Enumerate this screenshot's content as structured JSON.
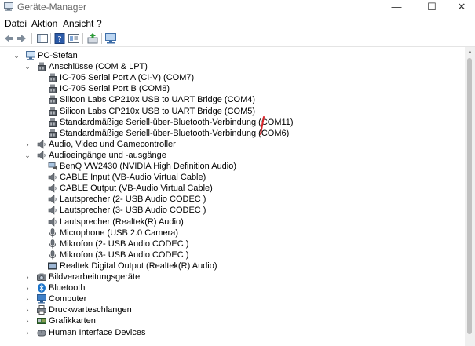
{
  "window": {
    "title": "Geräte-Manager",
    "controls": {
      "minimize": "—",
      "maximize": "☐",
      "close": "✕"
    }
  },
  "menu": [
    "Datei",
    "Aktion",
    "Ansicht",
    "?"
  ],
  "tree": [
    {
      "label": "PC-Stefan",
      "level": 0,
      "expander": "expanded",
      "icon": "computer-icon"
    },
    {
      "label": "Anschlüsse (COM & LPT)",
      "level": 1,
      "expander": "expanded",
      "icon": "port-icon"
    },
    {
      "label": "IC-705 Serial Port A (CI-V) (COM7)",
      "level": 2,
      "expander": "none",
      "icon": "port-icon"
    },
    {
      "label": "IC-705 Serial Port B (COM8)",
      "level": 2,
      "expander": "none",
      "icon": "port-icon"
    },
    {
      "label": "Silicon Labs CP210x USB to UART Bridge (COM4)",
      "level": 2,
      "expander": "none",
      "icon": "port-icon"
    },
    {
      "label": "Silicon Labs CP210x USB to UART Bridge (COM5)",
      "level": 2,
      "expander": "none",
      "icon": "port-icon"
    },
    {
      "label": "Standardmäßige Seriell-über-Bluetooth-Verbindung (COM11)",
      "level": 2,
      "expander": "none",
      "icon": "port-icon"
    },
    {
      "label": "Standardmäßige Seriell-über-Bluetooth-Verbindung (COM6)",
      "level": 2,
      "expander": "none",
      "icon": "port-icon"
    },
    {
      "label": "Audio, Video und Gamecontroller",
      "level": 1,
      "expander": "collapsed",
      "icon": "speaker-icon"
    },
    {
      "label": "Audioeingänge und -ausgänge",
      "level": 1,
      "expander": "expanded",
      "icon": "speaker-icon"
    },
    {
      "label": "BenQ VW2430 (NVIDIA High Definition Audio)",
      "level": 2,
      "expander": "none",
      "icon": "monitor-audio-icon"
    },
    {
      "label": "CABLE Input (VB-Audio Virtual Cable)",
      "level": 2,
      "expander": "none",
      "icon": "speaker-icon"
    },
    {
      "label": "CABLE Output (VB-Audio Virtual Cable)",
      "level": 2,
      "expander": "none",
      "icon": "speaker-icon"
    },
    {
      "label": "Lautsprecher (2- USB Audio CODEC )",
      "level": 2,
      "expander": "none",
      "icon": "speaker-icon"
    },
    {
      "label": "Lautsprecher (3- USB Audio CODEC )",
      "level": 2,
      "expander": "none",
      "icon": "speaker-icon"
    },
    {
      "label": "Lautsprecher (Realtek(R) Audio)",
      "level": 2,
      "expander": "none",
      "icon": "speaker-icon"
    },
    {
      "label": "Microphone (USB 2.0 Camera)",
      "level": 2,
      "expander": "none",
      "icon": "microphone-icon"
    },
    {
      "label": "Mikrofon (2- USB Audio CODEC )",
      "level": 2,
      "expander": "none",
      "icon": "microphone-icon"
    },
    {
      "label": "Mikrofon (3- USB Audio CODEC )",
      "level": 2,
      "expander": "none",
      "icon": "microphone-icon"
    },
    {
      "label": "Realtek Digital Output (Realtek(R) Audio)",
      "level": 2,
      "expander": "none",
      "icon": "digital-output-icon"
    },
    {
      "label": "Bildverarbeitungsgeräte",
      "level": 1,
      "expander": "collapsed",
      "icon": "camera-icon"
    },
    {
      "label": "Bluetooth",
      "level": 1,
      "expander": "collapsed",
      "icon": "bluetooth-icon"
    },
    {
      "label": "Computer",
      "level": 1,
      "expander": "collapsed",
      "icon": "monitor-icon"
    },
    {
      "label": "Druckwarteschlangen",
      "level": 1,
      "expander": "collapsed",
      "icon": "printer-icon"
    },
    {
      "label": "Grafikkarten",
      "level": 1,
      "expander": "collapsed",
      "icon": "display-adapter-icon"
    },
    {
      "label": "Human Interface Devices",
      "level": 1,
      "expander": "collapsed",
      "icon": "hid-icon"
    }
  ]
}
